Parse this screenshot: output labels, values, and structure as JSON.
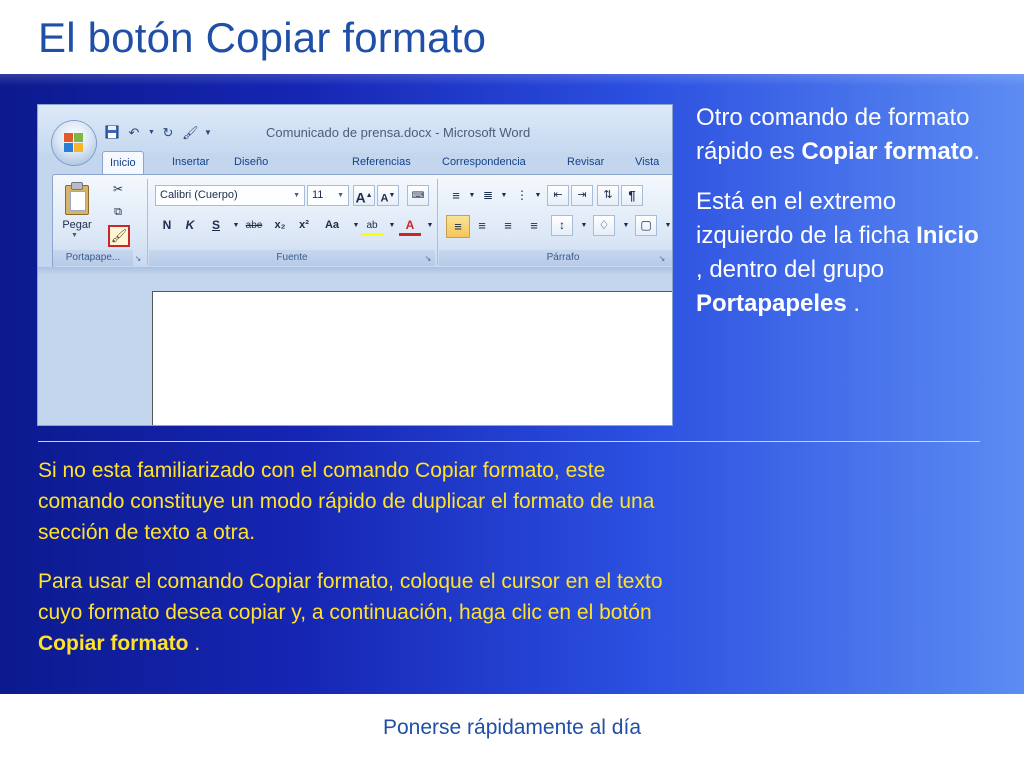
{
  "slide": {
    "title": "El botón Copiar formato",
    "footer": "Ponerse rápidamente al día"
  },
  "side_text": {
    "p1_a": "Otro comando de formato rápido es ",
    "p1_b": "Copiar formato",
    "p1_c": ".",
    "p2_a": "Está en el extremo izquierdo de la ficha ",
    "p2_b": "Inicio",
    "p2_c": " , dentro del grupo ",
    "p2_d": "Portapapeles",
    "p2_e": " ."
  },
  "body_text": {
    "p1": "Si no esta familiarizado con el comando Copiar formato, este comando constituye un modo rápido de duplicar el formato de una sección de texto a otra.",
    "p2_a": "Para usar el comando Copiar formato, coloque el cursor en el texto cuyo formato desea copiar y, a continuación, haga clic en el botón ",
    "p2_b": "Copiar formato",
    "p2_c": " ."
  },
  "colors": {
    "title": "#1f4fa6",
    "panel_dark": "#0c1a8e",
    "panel_light": "#5c8cf3",
    "body_text": "#ffe22a",
    "side_text": "#ffffff",
    "highlight_box": "#c8282a"
  },
  "word": {
    "window_title": "Comunicado de prensa.docx - Microsoft Word",
    "tabs": [
      "Inicio",
      "Insertar",
      "Diseño de página",
      "Referencias",
      "Correspondencia",
      "Revisar",
      "Vista"
    ],
    "active_tab": "Inicio",
    "font_name": "Calibri (Cuerpo)",
    "font_size": "11",
    "pegar_label": "Pegar",
    "groups": {
      "portapapeles": "Portapapeles",
      "portapapeles_short": "Portapape...",
      "fuente": "Fuente",
      "parrafo": "Párrafo"
    },
    "font_buttons": {
      "bold": "N",
      "italic": "K",
      "underline": "S",
      "strike": "abe",
      "subscript": "x₂",
      "superscript": "x²",
      "change_case": "Aa",
      "highlight": "ab",
      "font_color": "A"
    },
    "grow_font": "A",
    "shrink_font": "A",
    "pilcrow": "¶",
    "icons": {
      "office": "office-button-icon",
      "save": "save-icon",
      "undo": "undo-icon",
      "redo": "redo-icon",
      "cut": "scissors-icon",
      "copy": "copy-icon",
      "format_painter": "paintbrush-icon",
      "paste": "clipboard-icon"
    }
  }
}
